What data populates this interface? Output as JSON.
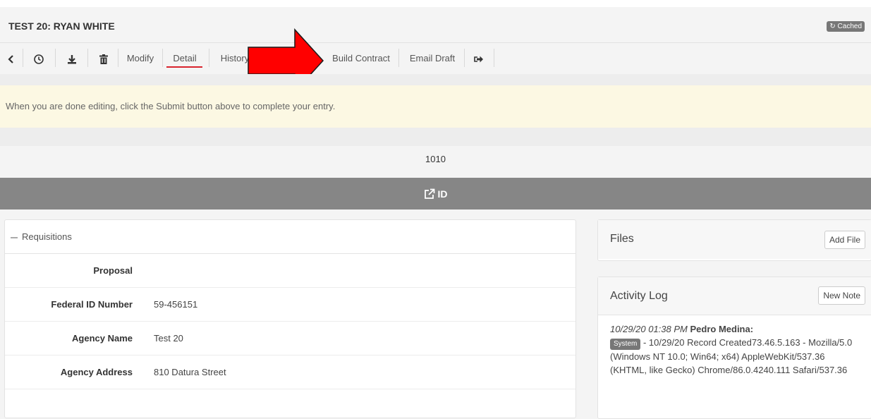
{
  "header": {
    "title": "TEST 20: RYAN WHITE",
    "cached_label": "Cached"
  },
  "toolbar": {
    "modify": "Modify",
    "detail": "Detail",
    "history": "History",
    "build_contract": "Build Contract",
    "email_draft": "Email Draft",
    "active_tab": "Detail"
  },
  "alert": {
    "message": "When you are done editing, click the Submit button above to complete your entry."
  },
  "record": {
    "number": "1010",
    "id_label": "ID"
  },
  "requisitions": {
    "header": "Requisitions",
    "fields": [
      {
        "label": "Proposal",
        "value": ""
      },
      {
        "label": "Federal ID Number",
        "value": "59-456151"
      },
      {
        "label": "Agency Name",
        "value": "Test 20"
      },
      {
        "label": "Agency Address",
        "value": "810 Datura Street"
      }
    ]
  },
  "files": {
    "title": "Files",
    "add_button": "Add File"
  },
  "activity": {
    "title": "Activity Log",
    "new_note_button": "New Note",
    "entry": {
      "timestamp": "10/29/20 01:38 PM",
      "user": "Pedro Medina:",
      "badge": "System",
      "text": "- 10/29/20 Record Created73.46.5.163 - Mozilla/5.0 (Windows NT 10.0; Win64; x64) AppleWebKit/537.36 (KHTML, like Gecko) Chrome/86.0.4240.111 Safari/537.36"
    }
  },
  "colors": {
    "accent_red": "#d9232d",
    "alert_bg": "#fcf8e3",
    "id_bar": "#868686",
    "annotation_arrow": "#ff0000"
  },
  "icons": [
    "chevron-left-icon",
    "clock-icon",
    "download-icon",
    "trash-icon",
    "sign-out-icon",
    "refresh-icon",
    "external-link-icon"
  ]
}
